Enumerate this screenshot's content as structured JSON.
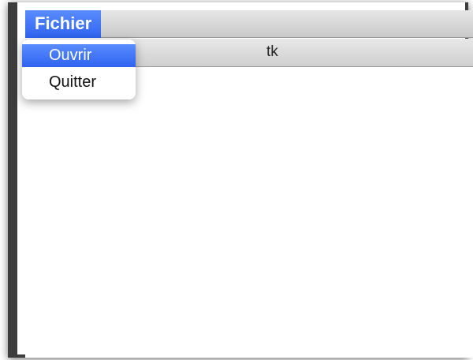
{
  "menubar": {
    "menu": "Fichier"
  },
  "window": {
    "title": "tk"
  },
  "dropdown": {
    "items": [
      {
        "label": "Ouvrir"
      },
      {
        "label": "Quitter"
      }
    ]
  }
}
